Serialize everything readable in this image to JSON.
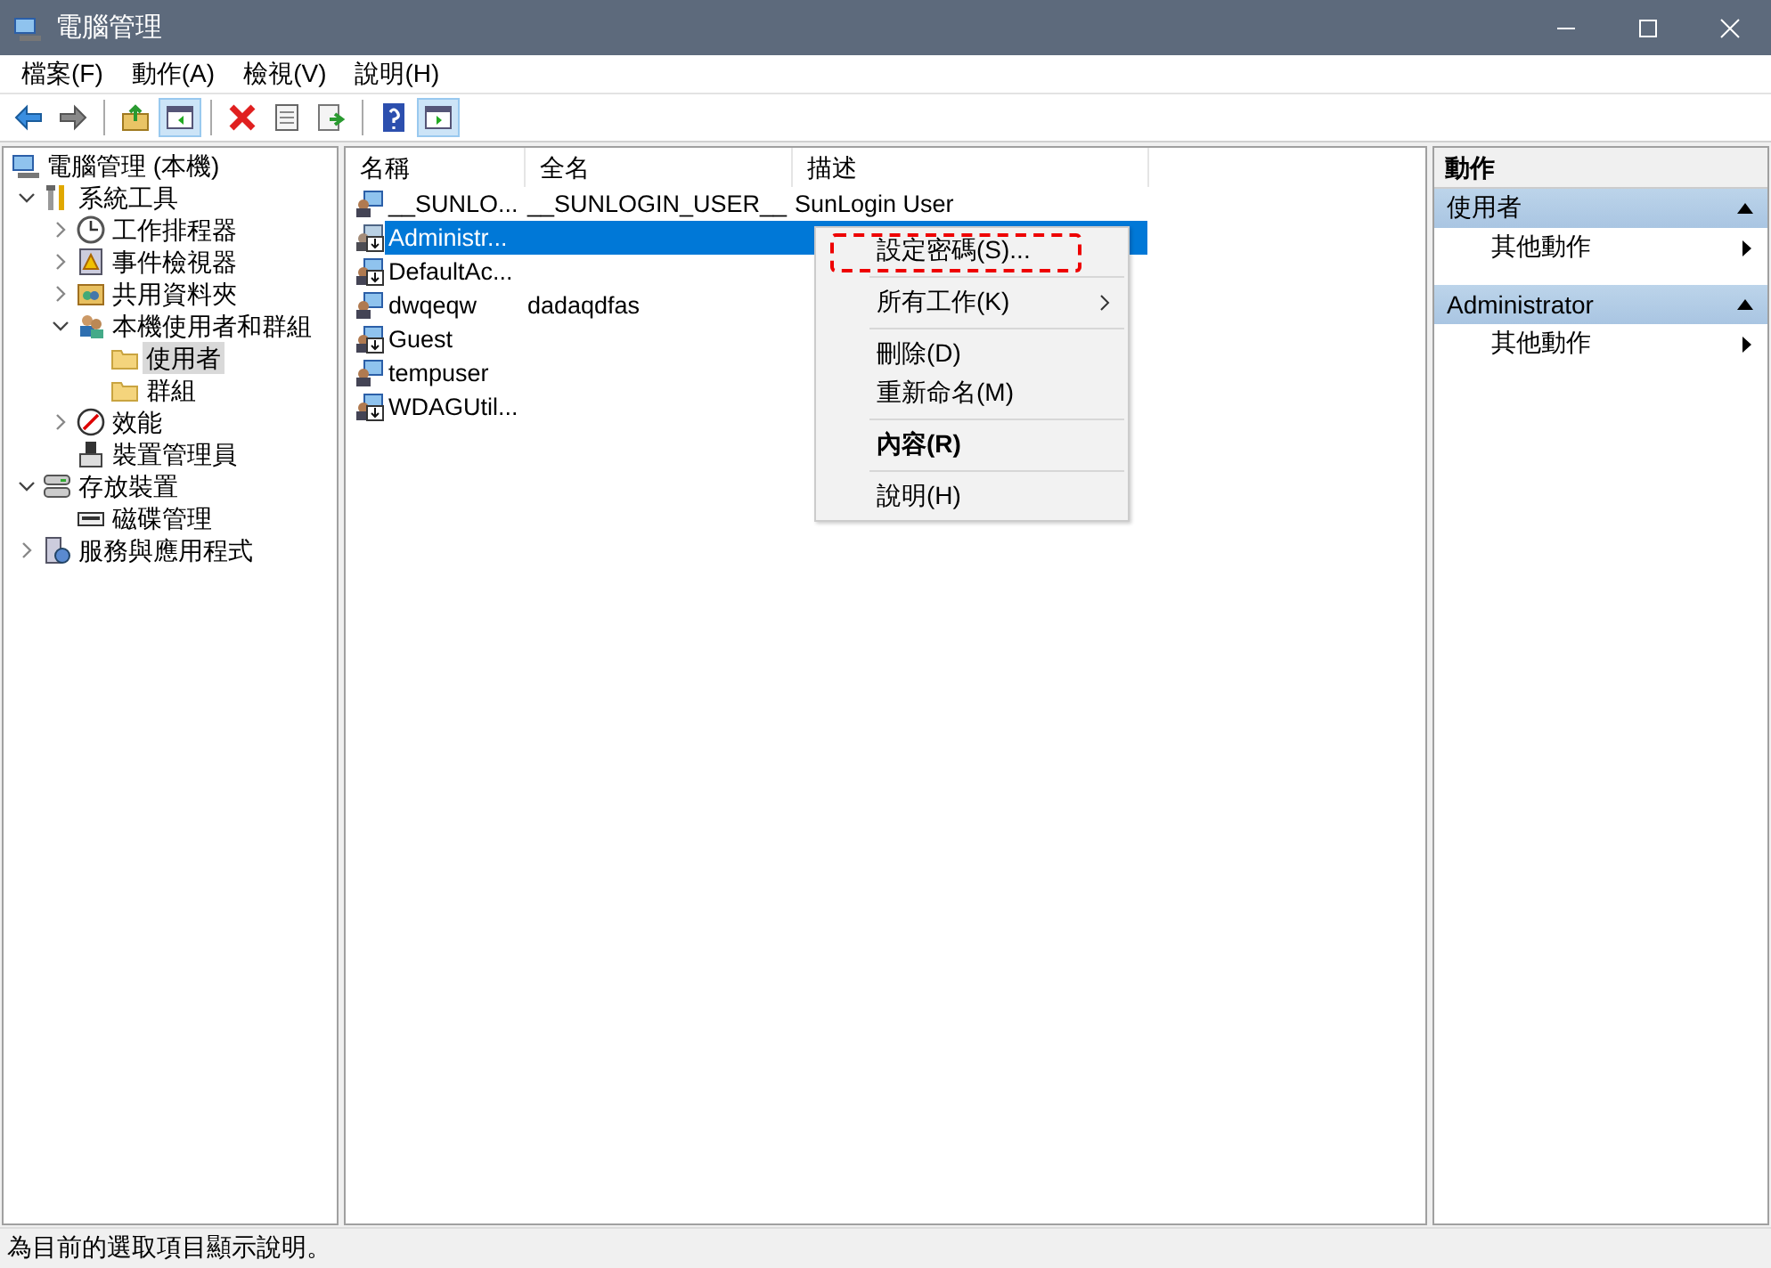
{
  "window": {
    "title": "電腦管理"
  },
  "menu_bar": [
    "檔案(F)",
    "動作(A)",
    "檢視(V)",
    "說明(H)"
  ],
  "toolbar": [
    {
      "kind": "button",
      "pressed": false
    },
    {
      "kind": "button",
      "pressed": false
    },
    {
      "kind": "separator"
    },
    {
      "kind": "button",
      "pressed": false
    },
    {
      "kind": "button",
      "pressed": true
    },
    {
      "kind": "separator"
    },
    {
      "kind": "button",
      "pressed": false
    },
    {
      "kind": "button",
      "pressed": false
    },
    {
      "kind": "button",
      "pressed": false
    },
    {
      "kind": "separator"
    },
    {
      "kind": "button",
      "pressed": false
    },
    {
      "kind": "button",
      "pressed": true
    }
  ],
  "tree": [
    {
      "label": "電腦管理 (本機)",
      "selected": false,
      "children": [
        {
          "label": "系統工具",
          "selected": false,
          "expanded": true,
          "children": [
            {
              "label": "工作排程器",
              "selected": false,
              "expanded": false
            },
            {
              "label": "事件檢視器",
              "selected": false,
              "expanded": false
            },
            {
              "label": "共用資料夾",
              "selected": false,
              "expanded": false
            },
            {
              "label": "本機使用者和群組",
              "selected": false,
              "expanded": true,
              "children": [
                {
                  "label": "使用者",
                  "selected": true
                },
                {
                  "label": "群組",
                  "selected": false
                }
              ]
            },
            {
              "label": "效能",
              "selected": false,
              "expanded": false
            },
            {
              "label": "裝置管理員",
              "selected": false
            }
          ]
        },
        {
          "label": "存放裝置",
          "selected": false,
          "expanded": true,
          "children": [
            {
              "label": "磁碟管理",
              "selected": false
            }
          ]
        },
        {
          "label": "服務與應用程式",
          "selected": false,
          "expanded": false
        }
      ]
    }
  ],
  "table": {
    "columns": [
      "名稱",
      "全名",
      "描述"
    ],
    "rows": [
      {
        "name": "__SUNLO...",
        "full_name": "__SUNLOGIN_USER__",
        "description": "SunLogin User",
        "disabled": false,
        "selected": false
      },
      {
        "name": "Administr...",
        "disabled": true,
        "selected": true
      },
      {
        "name": "DefaultAc...",
        "disabled": true,
        "selected": false
      },
      {
        "name": "dwqeqw",
        "full_name": "dadaqdfas",
        "disabled": false,
        "selected": false
      },
      {
        "name": "Guest",
        "disabled": true,
        "selected": false
      },
      {
        "name": "tempuser",
        "disabled": false,
        "selected": false
      },
      {
        "name": "WDAGUtil...",
        "disabled": true,
        "selected": false
      }
    ]
  },
  "context_menu": {
    "items": [
      {
        "kind": "item",
        "label": "設定密碼(S)...",
        "default": false,
        "submenu": false,
        "highlighted": true
      },
      {
        "kind": "separator"
      },
      {
        "kind": "item",
        "label": "所有工作(K)",
        "default": false,
        "submenu": true,
        "highlighted": false
      },
      {
        "kind": "separator"
      },
      {
        "kind": "item",
        "label": "刪除(D)",
        "default": false,
        "submenu": false,
        "highlighted": false
      },
      {
        "kind": "item",
        "label": "重新命名(M)",
        "default": false,
        "submenu": false,
        "highlighted": false
      },
      {
        "kind": "separator"
      },
      {
        "kind": "item",
        "label": "內容(R)",
        "default": true,
        "submenu": false,
        "highlighted": false
      },
      {
        "kind": "separator"
      },
      {
        "kind": "item",
        "label": "說明(H)",
        "default": false,
        "submenu": false,
        "highlighted": false
      }
    ]
  },
  "actions": {
    "title": "動作",
    "groups": [
      {
        "title": "使用者",
        "expanded": true,
        "items": [
          "其他動作"
        ]
      },
      {
        "title": "Administrator",
        "expanded": true,
        "items": [
          "其他動作"
        ]
      }
    ]
  },
  "status_bar": "為目前的選取項目顯示說明。"
}
